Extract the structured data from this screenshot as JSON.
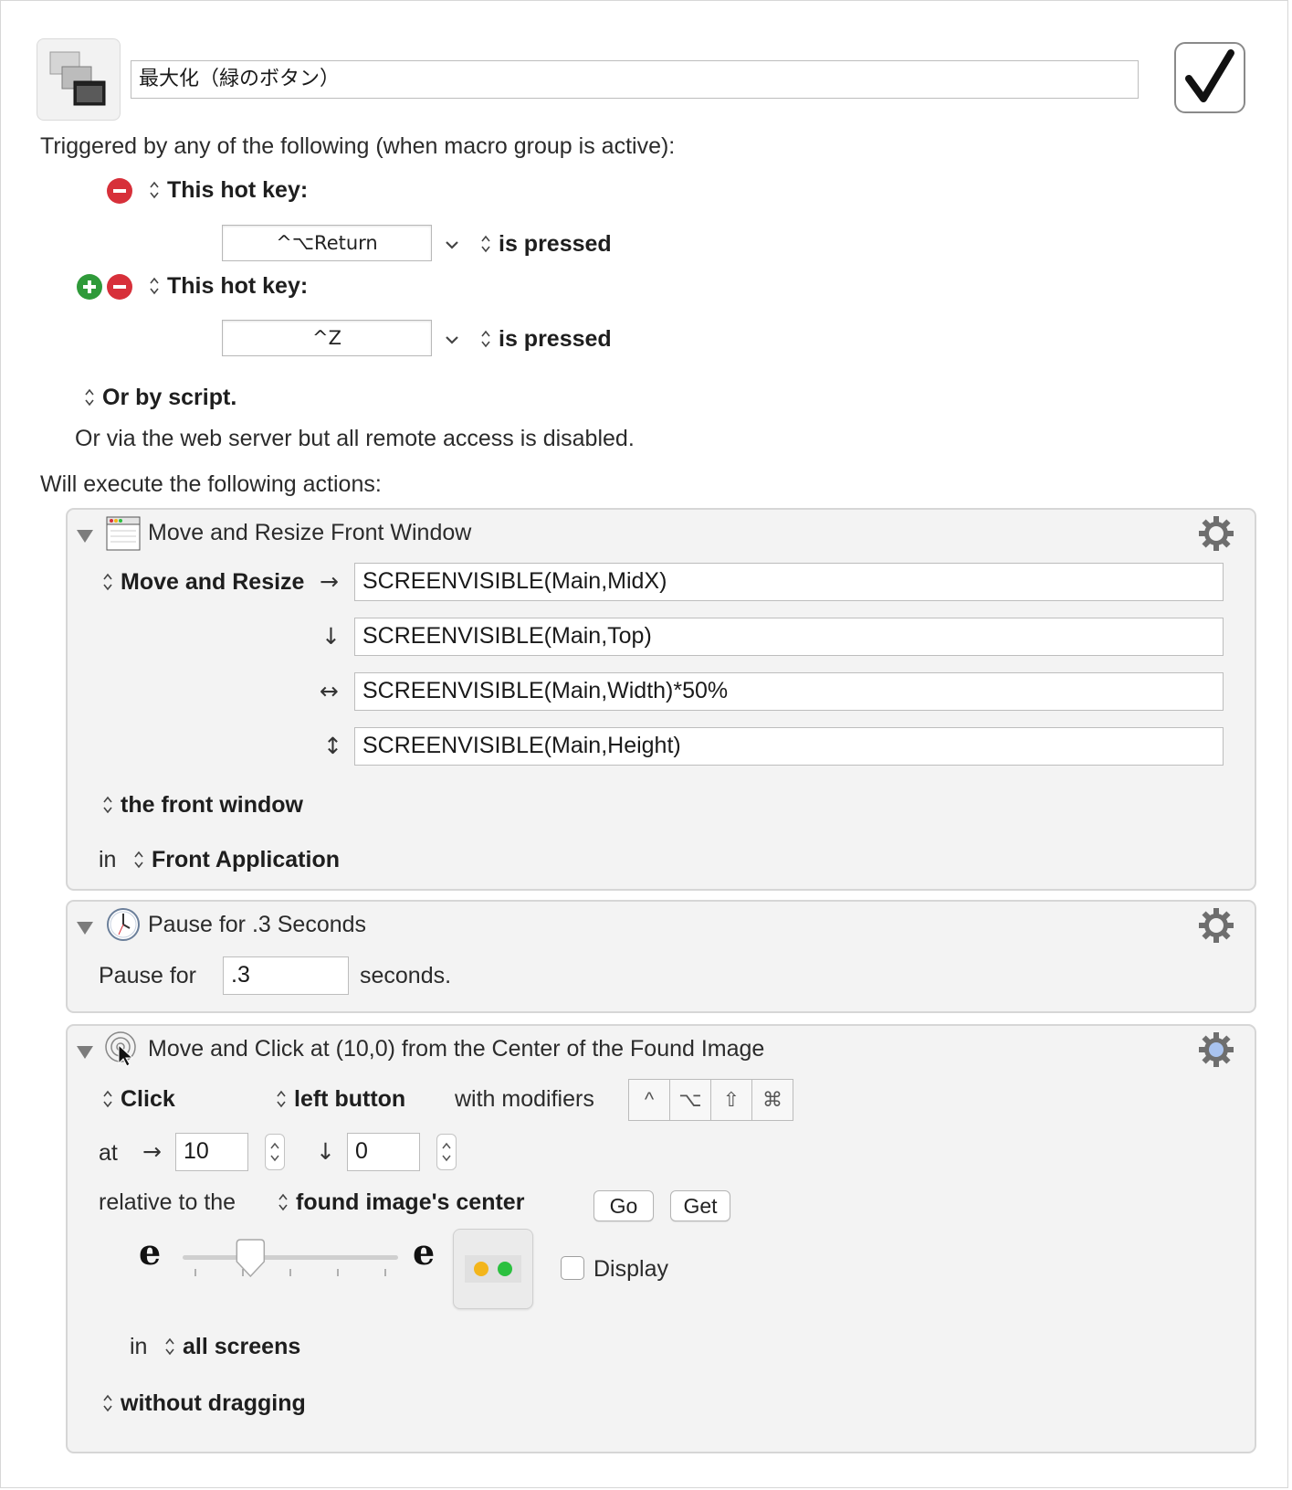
{
  "macro": {
    "name": "最大化（緑のボタン）",
    "enabled_icon": "checkmark-icon",
    "icon": "window-stack-icon"
  },
  "triggers": {
    "heading": "Triggered by any of the following (when macro group is active):",
    "hotkeys": [
      {
        "label": "This hot key:",
        "key": "^⌥Return",
        "state": "is pressed"
      },
      {
        "label": "This hot key:",
        "key": "^Z",
        "state": "is pressed"
      }
    ],
    "script_label": "Or by script.",
    "web_server_note": "Or via the web server but all remote access is disabled."
  },
  "actions_heading": "Will execute the following actions:",
  "action1": {
    "title": "Move and Resize Front Window",
    "mode": "Move and Resize",
    "arrows": [
      "→",
      "↓",
      "↔",
      "↕"
    ],
    "x": "SCREENVISIBLE(Main,MidX)",
    "y": "SCREENVISIBLE(Main,Top)",
    "width": "SCREENVISIBLE(Main,Width)*50%",
    "height": "SCREENVISIBLE(Main,Height)",
    "target": "the front window",
    "in_label": "in",
    "app": "Front Application"
  },
  "action2": {
    "title": "Pause for .3 Seconds",
    "pause_label": "Pause for",
    "value": ".3",
    "unit": "seconds."
  },
  "action3": {
    "title": "Move and Click at (10,0) from the Center of the Found Image",
    "click": "Click",
    "button": "left button",
    "modifiers_label": "with modifiers",
    "modifier_keys": [
      "^",
      "⌥",
      "⇧",
      "⌘"
    ],
    "at_label": "at",
    "arrow_x": "→",
    "arrow_y": "↓",
    "x": "10",
    "y": "0",
    "relative_label": "relative to the",
    "anchor": "found image's center",
    "go": "Go",
    "get": "Get",
    "fuzz_min_glyph": "e",
    "fuzz_max_glyph": "e",
    "fuzz_level": 0.29,
    "display_label": "Display",
    "display_checked": false,
    "screens_in": "in",
    "screens": "all screens",
    "drag": "without dragging"
  },
  "colors": {
    "remove": "#d7303a",
    "add": "#2f9a3a",
    "traffic_yellow": "#f3b51b",
    "traffic_green": "#2bc03f",
    "action_bg": "#f3f3f3"
  }
}
